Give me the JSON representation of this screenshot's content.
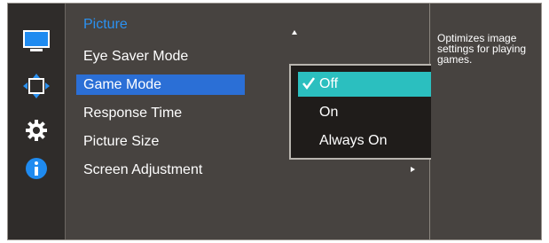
{
  "sidebar": {
    "icons": [
      "monitor-icon",
      "move-arrows-icon",
      "gear-icon",
      "info-icon"
    ]
  },
  "menu": {
    "title": "Picture",
    "items": [
      {
        "label": "Eye Saver Mode"
      },
      {
        "label": "Game Mode"
      },
      {
        "label": "Response Time"
      },
      {
        "label": "Picture Size"
      },
      {
        "label": "Screen Adjustment"
      }
    ]
  },
  "submenu": {
    "options": [
      {
        "label": "Off"
      },
      {
        "label": "On"
      },
      {
        "label": "Always On"
      }
    ],
    "selected": "Off"
  },
  "help": {
    "text": "Optimizes image settings for playing games."
  },
  "colors": {
    "selected_menu": "#2b6fd6",
    "selected_option": "#2bbfbf",
    "title": "#2b91f0"
  }
}
